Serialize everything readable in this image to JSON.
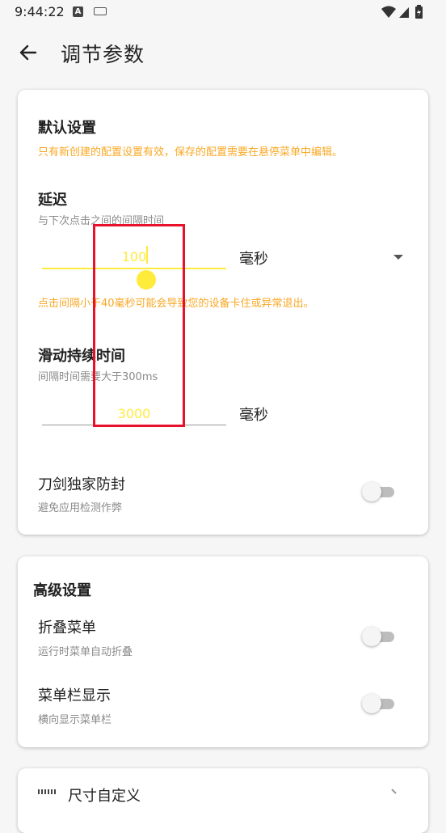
{
  "status": {
    "time": "9:44:22",
    "a_badge": "A"
  },
  "header": {
    "title": "调节参数"
  },
  "defaults": {
    "title": "默认设置",
    "notice": "只有新创建的配置设置有效，保存的配置需要在悬停菜单中编辑。",
    "delay": {
      "label": "延迟",
      "desc": "与下次点击之间的间隔时间",
      "value": "100",
      "unit": "毫秒",
      "warning": "点击间隔小于40毫秒可能会导致您的设备卡住或异常退出。"
    },
    "swipe": {
      "label": "滑动持续时间",
      "desc": "间隔时间需要大于300ms",
      "value": "3000",
      "unit": "毫秒"
    },
    "anti_ban": {
      "label": "刀剑独家防封",
      "desc": "避免应用检测作弊",
      "enabled": false
    }
  },
  "advanced": {
    "title": "高级设置",
    "fold_menu": {
      "label": "折叠菜单",
      "desc": "运行时菜单自动折叠",
      "enabled": false
    },
    "menu_bar": {
      "label": "菜单栏显示",
      "desc": "横向显示菜单栏",
      "enabled": false
    }
  },
  "next_card": {
    "label": "尺寸自定义"
  },
  "colors": {
    "accent": "#ffeb3b",
    "warning": "#f9a825",
    "highlight_box": "#e8102a"
  }
}
